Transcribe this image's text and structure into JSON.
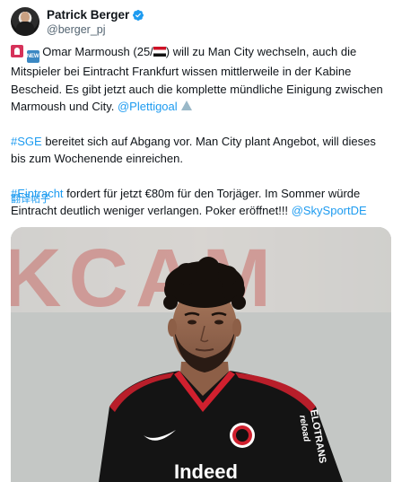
{
  "author": {
    "display_name": "Patrick Berger",
    "handle": "@berger_pj",
    "avatar_icon": "avatar",
    "verified_icon": "verified-badge-icon"
  },
  "tweet": {
    "p1_part1": "Omar Marmoush (25/",
    "p1_part2": ") will zu Man City wechseln, auch die Mitspieler bei Eintracht Frankfurt wissen mittlerweile in der Kabine Bescheid. Es gibt jetzt auch die komplette mündliche Einigung zwischen Marmoush und City.",
    "p1_mention": "@Plettigoal",
    "p2_hashtag": "#SGE",
    "p2_text": "bereitet sich auf Abgang vor. Man City plant Angebot, will dieses bis zum Wochenende einreichen.",
    "p3_hashtag": "#Eintracht",
    "p3_text": "fordert für jetzt €80m für den Torjäger. Im Sommer würde Eintracht deutlich weniger verlangen. Poker eröffnet!!!",
    "p3_mention": "@SkySportDE",
    "translate_label": "翻译帖子"
  },
  "media": {
    "description_alt": "Omar Marmoush",
    "jersey_text_sleeve": "ELOTRANS",
    "jersey_text_sleeve2": "reload",
    "jersey_sponsor": "Indeed",
    "background_text": "KCAM"
  },
  "colors": {
    "link": "#1d9bf0",
    "handle": "#536471",
    "text": "#0f1419",
    "jersey": "#141414",
    "jersey_accent": "#d0202e"
  }
}
